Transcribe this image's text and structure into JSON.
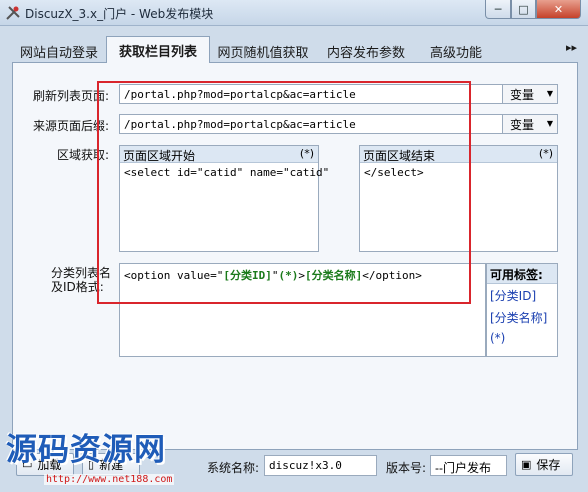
{
  "window": {
    "title": "DiscuzX_3.x_门户 - Web发布模块",
    "min_glyph": "─",
    "max_glyph": "□",
    "close_glyph": "✕"
  },
  "tabs": [
    "网站自动登录",
    "获取栏目列表",
    "网页随机值获取",
    "内容发布参数",
    "高级功能"
  ],
  "tab_scroll_glyph": "▸▸",
  "form": {
    "refresh_label": "刷新列表页面:",
    "refresh_value": "/portal.php?mod=portalcp&ac=article",
    "source_label": "来源页面后缀:",
    "source_value": "/portal.php?mod=portalcp&ac=article",
    "variable_label": "变量",
    "region_label": "区域获取:",
    "region_start": {
      "title": "页面区域开始",
      "flag": "(*)",
      "value": "<select id=\"catid\" name=\"catid\""
    },
    "region_end": {
      "title": "页面区域结束",
      "flag": "(*)",
      "value": "</select>"
    },
    "format_label_line1": "分类列表名",
    "format_label_line2": "及ID格式:",
    "format": {
      "prefix": "<option value=\"",
      "tag_id": "[分类ID]",
      "mid1": "\"",
      "wildcard": "(*)",
      "mid2": ">",
      "tag_name": "[分类名称]",
      "suffix": "</option>"
    },
    "available_tags": {
      "title": "可用标签:",
      "items": [
        "[分类ID]",
        "[分类名称]",
        "(*)"
      ]
    }
  },
  "bottom": {
    "load_label": "加载",
    "new_label": "新建",
    "system_name_label": "系统名称:",
    "system_name_value": "discuz!x3.0",
    "version_label": "版本号:",
    "version_value": "--门户发布",
    "save_label": "保存"
  },
  "watermark": {
    "text": "源码资源网",
    "url": "http://www.net188.com"
  },
  "colors": {
    "highlight_box": "#d9252c",
    "tag_text": "#1a3fb0",
    "format_tag": "#1a7a1a"
  }
}
